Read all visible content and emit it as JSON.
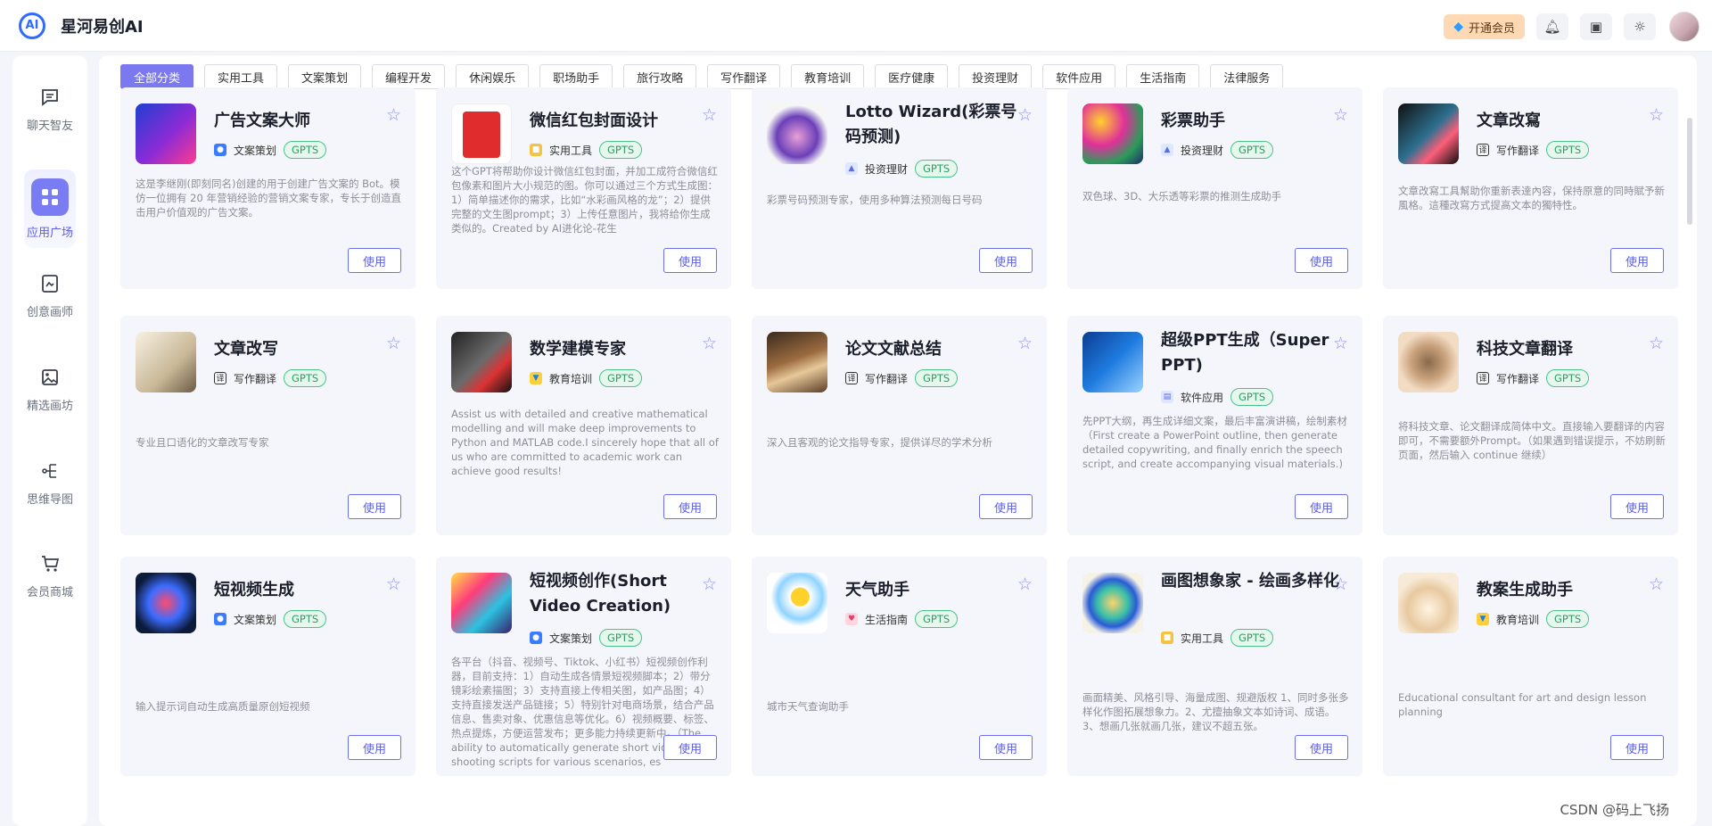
{
  "header": {
    "brand": "星河易创AI",
    "vip_label": "开通会员"
  },
  "sidebar": {
    "items": [
      {
        "label": "聊天智友",
        "icon": "chat-icon"
      },
      {
        "label": "应用广场",
        "icon": "apps-grid-icon",
        "active": true
      },
      {
        "label": "创意画师",
        "icon": "draw-icon"
      },
      {
        "label": "精选画坊",
        "icon": "gallery-icon"
      },
      {
        "label": "思维导图",
        "icon": "mindmap-icon"
      },
      {
        "label": "会员商城",
        "icon": "cart-icon"
      }
    ]
  },
  "tabs": [
    "全部分类",
    "实用工具",
    "文案策划",
    "编程开发",
    "休闲娱乐",
    "职场助手",
    "旅行攻略",
    "写作翻译",
    "教育培训",
    "医疗健康",
    "投资理财",
    "软件应用",
    "生活指南",
    "法律服务"
  ],
  "use_label": "使用",
  "badge_label": "GPTS",
  "cards": [
    {
      "title": "广告文案大师",
      "category": "文案策划",
      "desc": "这是李继刚(即刻同名)创建的用于创建广告文案的 Bot。模仿一位拥有 20 年营销经验的营销文案专家，专长于创造直击用户价值观的广告文案。"
    },
    {
      "title": "微信红包封面设计",
      "category": "实用工具",
      "desc": "这个GPT将帮助你设计微信红包封面，并加工成符合微信红包像素和图片大小规范的图。你可以通过三个方式生成图：1）简单描述你的需求，比如“水彩画风格的龙”；2）提供完整的文生图prompt；3）上传任意图片，我将给你生成类似的。Created by AI进化论-花生"
    },
    {
      "title": "Lotto Wizard(彩票号码预测)",
      "category": "投资理财",
      "desc": "彩票号码预测专家，使用多种算法预测每日号码"
    },
    {
      "title": "彩票助手",
      "category": "投资理财",
      "desc": "双色球、3D、大乐透等彩票的推测生成助手"
    },
    {
      "title": "文章改寫",
      "category": "写作翻译",
      "desc": "文章改寫工具幫助你重新表達內容，保持原意的同時賦予新風格。這種改寫方式提高文本的獨特性。"
    },
    {
      "title": "文章改写",
      "category": "写作翻译",
      "desc": "专业且口语化的文章改写专家"
    },
    {
      "title": "数学建模专家",
      "category": "教育培训",
      "desc": "Assist us with detailed and creative mathematical modelling and will make deep improvements to Python and MATLAB code.I sincerely hope that all of us who are committed to academic work can achieve good results!"
    },
    {
      "title": "论文文献总结",
      "category": "写作翻译",
      "desc": "深入且客观的论文指导专家，提供详尽的学术分析"
    },
    {
      "title": "超级PPT生成（Super PPT)",
      "category": "软件应用",
      "desc": "先PPT大纲，再生成详细文案，最后丰富演讲稿，绘制素材（First create a PowerPoint outline, then generate detailed copywriting, and finally enrich the speech script, and create accompanying visual materials.)"
    },
    {
      "title": "科技文章翻译",
      "category": "写作翻译",
      "desc": "将科技文章、论文翻译成简体中文。直接输入要翻译的内容即可，不需要额外Prompt。（如果遇到错误提示，不妨刷新页面，然后输入 continue 继续）"
    },
    {
      "title": "短视频生成",
      "category": "文案策划",
      "desc": "输入提示词自动生成高质量原创短视频"
    },
    {
      "title": "短视频创作(Short Video Creation)",
      "category": "文案策划",
      "desc": "各平台（抖音、视频号、Tiktok、小红书）短视频创作利器，目前支持：1）自动生成各情景短视频脚本；2）带分镜彩绘素描图；3）支持直接上传相关图，如产品图；4）支持直接发送产品链接；5）特别针对电商场景，结合产品信息、售卖对象、优惠信息等优化。6）视频概要、标签、热点提炼，方便运营发布；更多能力持续更新中。（The ability to automatically generate short video shooting scripts for various scenarios, es"
    },
    {
      "title": "天气助手",
      "category": "生活指南",
      "desc": "城市天气查询助手"
    },
    {
      "title": "画图想象家 - 绘画多样化",
      "category": "实用工具",
      "desc": "画面精美、风格引导、海量成图、规避版权 1、同时多张多样化作图拓展想象力。2、尤擅抽象文本如诗词、成语。3、想画几张就画几张，建议不超五张。"
    },
    {
      "title": "教案生成助手",
      "category": "教育培训",
      "desc": "Educational consultant for art and design lesson planning"
    }
  ],
  "watermark": "CSDN @码上飞扬"
}
